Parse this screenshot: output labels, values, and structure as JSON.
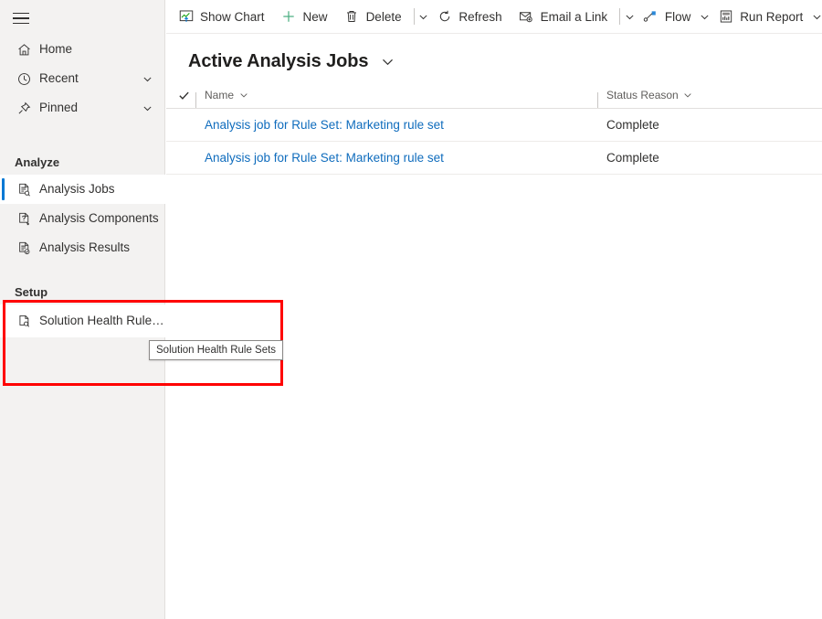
{
  "sidebar": {
    "menu_button": "menu-hamburger",
    "top_items": [
      {
        "label": "Home",
        "icon": "home-icon",
        "has_chevron": false
      },
      {
        "label": "Recent",
        "icon": "clock-icon",
        "has_chevron": true
      },
      {
        "label": "Pinned",
        "icon": "pin-icon",
        "has_chevron": true
      }
    ],
    "groups": [
      {
        "heading": "Analyze",
        "items": [
          {
            "label": "Analysis Jobs",
            "icon": "document-search-icon",
            "selected": true
          },
          {
            "label": "Analysis Components",
            "icon": "document-question-icon",
            "selected": false
          },
          {
            "label": "Analysis Results",
            "icon": "document-check-icon",
            "selected": false
          }
        ]
      },
      {
        "heading": "Setup",
        "items": [
          {
            "label": "Solution Health Rule ...",
            "icon": "document-magnify-icon",
            "selected": false,
            "highlighted": true
          }
        ]
      }
    ]
  },
  "tooltip": {
    "text": "Solution Health Rule Sets"
  },
  "annotation": {
    "color": "#ff0000"
  },
  "commandbar": {
    "items": [
      {
        "type": "button",
        "label": "Show Chart",
        "icon": "chart-icon"
      },
      {
        "type": "button",
        "label": "New",
        "icon": "plus-icon"
      },
      {
        "type": "button",
        "label": "Delete",
        "icon": "trash-icon"
      },
      {
        "type": "sep"
      },
      {
        "type": "caret",
        "icon": "chevron-down-icon"
      },
      {
        "type": "button",
        "label": "Refresh",
        "icon": "refresh-icon"
      },
      {
        "type": "button",
        "label": "Email a Link",
        "icon": "email-link-icon"
      },
      {
        "type": "sep"
      },
      {
        "type": "caret",
        "icon": "chevron-down-icon"
      },
      {
        "type": "button",
        "label": "Flow",
        "icon": "flow-icon"
      },
      {
        "type": "caret",
        "icon": "chevron-down-icon"
      },
      {
        "type": "button",
        "label": "Run Report",
        "icon": "report-icon"
      },
      {
        "type": "caret",
        "icon": "chevron-down-icon"
      }
    ]
  },
  "view": {
    "title": "Active Analysis Jobs",
    "selector_icon": "chevron-down-icon"
  },
  "grid": {
    "columns": [
      {
        "key": "name",
        "label": "Name"
      },
      {
        "key": "status",
        "label": "Status Reason"
      }
    ],
    "rows": [
      {
        "name": "Analysis job for Rule Set: Marketing rule set",
        "status": "Complete"
      },
      {
        "name": "Analysis job for Rule Set: Marketing rule set",
        "status": "Complete"
      }
    ]
  },
  "colors": {
    "accent": "#0078d4",
    "link": "#0f6cbd",
    "sidebar_bg": "#f3f2f1",
    "annotation": "#ff0000"
  }
}
